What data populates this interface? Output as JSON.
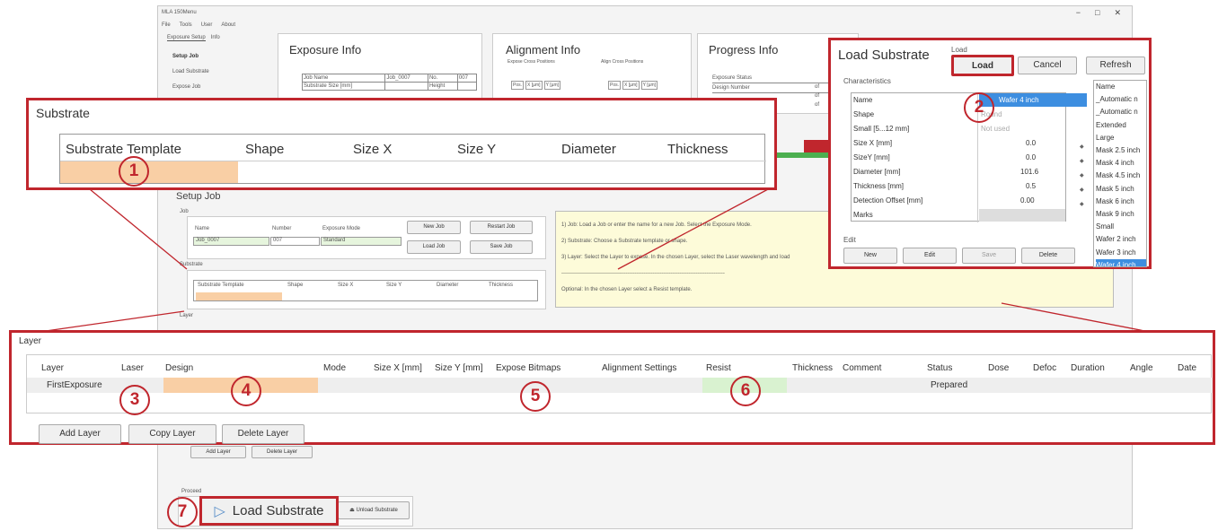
{
  "app": {
    "title": "MLA 150Menu",
    "menu": [
      "File",
      "Tools",
      "User",
      "About"
    ],
    "win_controls": [
      "−",
      "□",
      "✕"
    ],
    "tabs": [
      "Exposure Setup",
      "Info"
    ]
  },
  "nav": [
    "Setup Job",
    "Load Substrate",
    "Expose Job"
  ],
  "exposure_info": {
    "title": "Exposure Info",
    "rows": [
      [
        "Job Name",
        "Job_0007",
        "No.",
        "007"
      ],
      [
        "Substrate Size [mm]",
        "",
        "Height",
        ""
      ]
    ]
  },
  "alignment_info": {
    "title": "Alignment Info",
    "left": "Expose Cross Positions",
    "right": "Align Cross Positions",
    "cols_l": [
      "Pos.",
      "X [µm]",
      "Y [µm]"
    ],
    "cols_r": [
      "Pos.",
      "X [µm]",
      "Y [µm]"
    ]
  },
  "progress_info": {
    "title": "Progress Info",
    "rows": [
      "Exposure Status",
      "Design Number",
      "",
      ""
    ],
    "of": [
      "of",
      "of",
      "of"
    ]
  },
  "substrate_zoom": {
    "title": "Substrate",
    "headers": [
      "Substrate Template",
      "Shape",
      "Size X",
      "Size Y",
      "Diameter",
      "Thickness"
    ]
  },
  "setup_job": {
    "title": "Setup Job",
    "job_label": "Job",
    "name_h": "Name",
    "number_h": "Number",
    "mode_h": "Exposure Mode",
    "name": "Job_0007",
    "number": "007",
    "mode": "Standard",
    "btns": [
      "New Job",
      "Restart Job",
      "Load Job",
      "Save Job"
    ],
    "substrate_label": "Substrate",
    "sub_headers": [
      "Substrate Template",
      "Shape",
      "Size X",
      "Size Y",
      "Diameter",
      "Thickness"
    ],
    "layer_label": "Layer",
    "layer_btns": [
      "Add Layer",
      "Delete Layer"
    ]
  },
  "help": [
    "1) Job: Load a Job or enter the name for a new Job. Select the Exposure Mode.",
    "2) Substrate: Choose a Substrate template or shape.",
    "3) Layer: Select the Layer to expose. In the chosen Layer, select the Laser wavelength and load",
    "-------------------------------------------------------------------------------------------",
    "Optional: In the chosen Layer select a Resist template."
  ],
  "load_substrate": {
    "title": "Load Substrate",
    "load_group": "Load",
    "btns": [
      "Load",
      "Cancel",
      "Refresh"
    ],
    "char_label": "Characteristics",
    "rows": [
      [
        "Name",
        "Wafer 4 inch"
      ],
      [
        "Shape",
        "Round"
      ],
      [
        "Small [5...12 mm]",
        "Not used"
      ],
      [
        "Size X [mm]",
        "0.0"
      ],
      [
        "SizeY [mm]",
        "0.0"
      ],
      [
        "Diameter [mm]",
        "101.6"
      ],
      [
        "Thickness [mm]",
        "0.5"
      ],
      [
        "Detection Offset [mm]",
        "0.00"
      ],
      [
        "Marks",
        ""
      ]
    ],
    "edit_label": "Edit",
    "edit_btns": [
      "New",
      "Edit",
      "Save",
      "Delete"
    ],
    "list": [
      "Name",
      "_Automatic n",
      "_Automatic n",
      "Extended",
      "Large",
      "Mask 2.5 inch",
      "Mask 4 inch",
      "Mask 4.5 inch",
      "Mask 5 inch",
      "Mask 6 inch",
      "Mask 9 inch",
      "Small",
      "Wafer 2 inch",
      "Wafer 3 inch",
      "Wafer 4 inch"
    ]
  },
  "layer_zoom": {
    "title": "Layer",
    "headers": [
      "Layer",
      "Laser",
      "Design",
      "Mode",
      "Size X [mm]",
      "Size Y [mm]",
      "Expose Bitmaps",
      "Alignment Settings",
      "Resist",
      "Thickness",
      "Comment",
      "Status",
      "Dose",
      "Defoc",
      "Duration",
      "Angle",
      "Date"
    ],
    "row": {
      "layer": "FirstExposure",
      "status": "Prepared"
    },
    "btns": [
      "Add Layer",
      "Copy Layer",
      "Delete Layer"
    ]
  },
  "proceed": {
    "label": "Proceed",
    "load": "Load Substrate",
    "unload": "Unload Substrate"
  },
  "callouts": [
    "1",
    "2",
    "3",
    "4",
    "5",
    "6",
    "7"
  ],
  "colors": {
    "red": "#c0262d",
    "orange": "#f9cfa5",
    "green": "#d9f2d0",
    "selected": "#3d8ee0",
    "help_bg": "#fdfbd9"
  }
}
